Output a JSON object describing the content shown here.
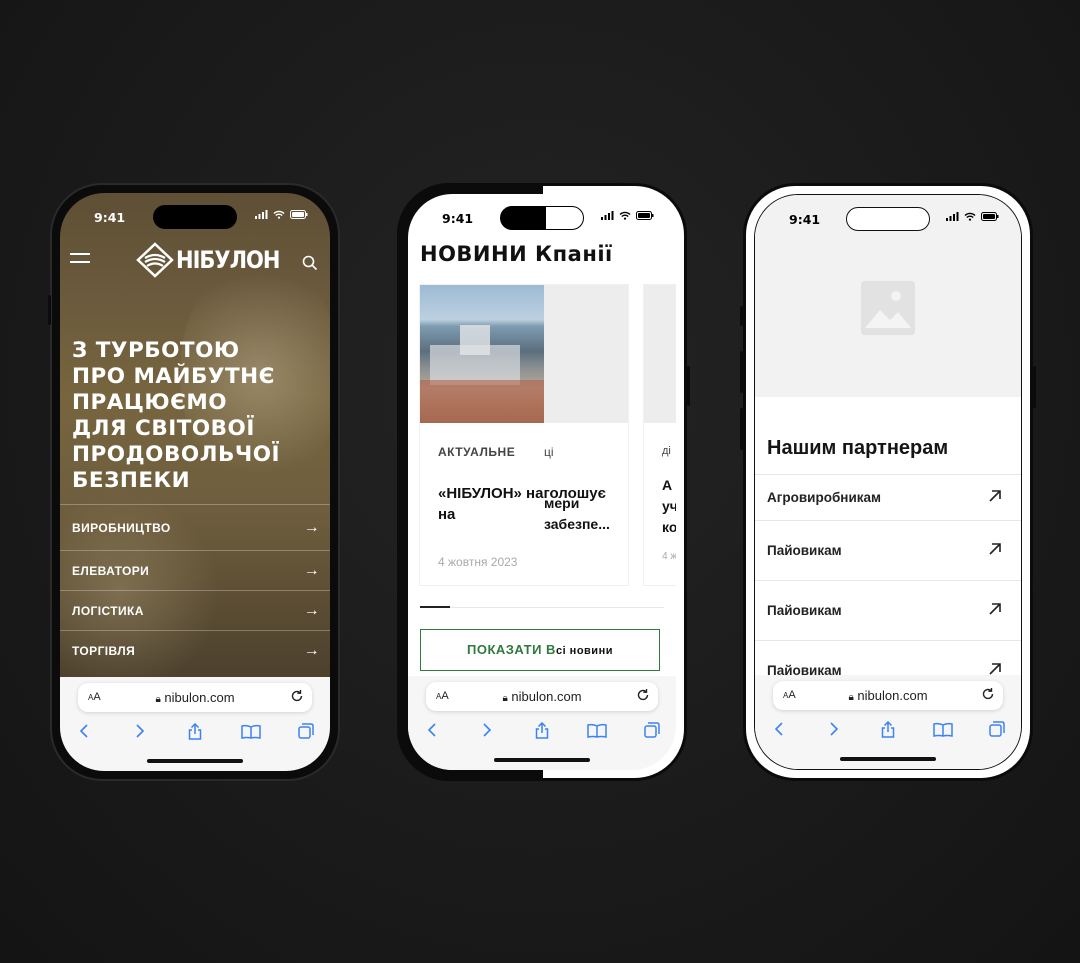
{
  "status": {
    "time": "9:41"
  },
  "browser": {
    "aa": "AA",
    "url": "nibulon.com"
  },
  "phone1": {
    "brand": "НІБУЛОН",
    "hero": [
      "З ТУРБОТОЮ",
      "ПРО МАЙБУТНЄ",
      "ПРАЦЮЄМО",
      "ДЛЯ СВІТОВОЇ",
      "ПРОДОВОЛЬЧОЇ",
      "БЕЗПЕКИ"
    ],
    "nav": [
      "ВИРОБНИЦТВО",
      "ЕЛЕВАТОРИ",
      "ЛОГІСТИКА",
      "ТОРГІВЛЯ"
    ]
  },
  "phone2": {
    "title_left": "НОВИНИ К",
    "title_right": "панії",
    "card1": {
      "tag": "АКТУАЛЬНЕ",
      "headline": "«НІБУЛОН» наголошує на",
      "date": "4 жовтня 2023"
    },
    "card1_right": {
      "tag": "ці",
      "headline_l1": "мери",
      "headline_l2": "забезпе..."
    },
    "card2": {
      "tag": "ді",
      "l1": "А",
      "l2": "уч",
      "l3": "ко",
      "date": "4 ж"
    },
    "button_left": "ПОКАЗАТИ В",
    "button_right": "сі новини"
  },
  "phone3": {
    "title": "Нашим партнерам",
    "links": [
      "Агровиробникам",
      "Пайовикам",
      "Пайовикам",
      "Пайовикам"
    ]
  },
  "colors": {
    "accent_green": "#2f7a3c",
    "background": "#1c1c1c"
  }
}
